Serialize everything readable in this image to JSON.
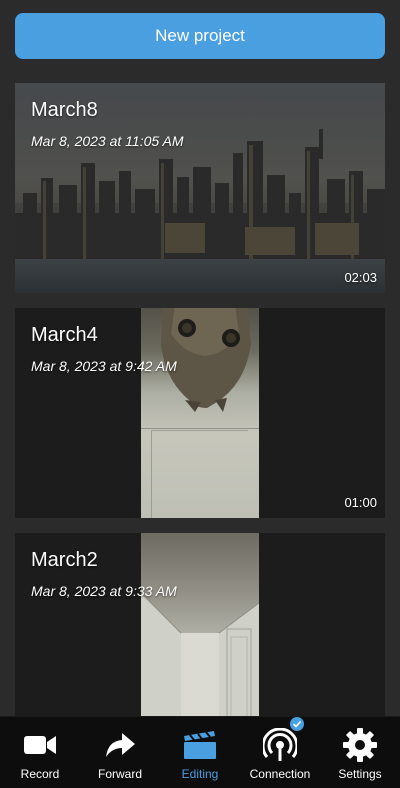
{
  "new_project": {
    "label": "New project"
  },
  "projects": [
    {
      "title": "March8",
      "date": "Mar 8, 2023 at 11:05 AM",
      "duration": "02:03"
    },
    {
      "title": "March4",
      "date": "Mar 8, 2023 at 9:42 AM",
      "duration": "01:00"
    },
    {
      "title": "March2",
      "date": "Mar 8, 2023 at 9:33 AM",
      "duration": ""
    }
  ],
  "tabs": [
    {
      "label": "Record",
      "icon": "video-camera-icon",
      "active": false
    },
    {
      "label": "Forward",
      "icon": "forward-arrow-icon",
      "active": false
    },
    {
      "label": "Editing",
      "icon": "clapperboard-icon",
      "active": true
    },
    {
      "label": "Connection",
      "icon": "broadcast-icon",
      "active": false,
      "badge": "checkmark-icon"
    },
    {
      "label": "Settings",
      "icon": "gear-icon",
      "active": false
    }
  ],
  "colors": {
    "accent": "#4a9fe0",
    "background": "#2b2b2b",
    "card": "#1c1c1c",
    "tabbar": "#0d0d0d"
  }
}
